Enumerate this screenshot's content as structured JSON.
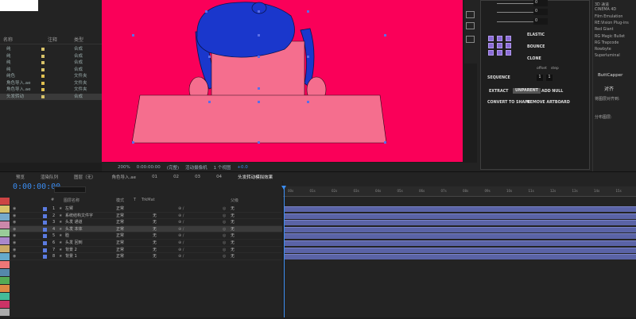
{
  "project": {
    "columns": {
      "name": "名称",
      "label": "注释",
      "type": "类型"
    },
    "rows": [
      {
        "name": "纯",
        "type": "合成",
        "swatch": "#d8c36a"
      },
      {
        "name": "纯",
        "type": "合成",
        "swatch": "#d8c36a"
      },
      {
        "name": "纯",
        "type": "合成",
        "swatch": "#d8c36a"
      },
      {
        "name": "纯",
        "type": "合成",
        "swatch": "#d8c36a"
      },
      {
        "name": "纯色",
        "type": "文件夹",
        "swatch": "#e0c050"
      },
      {
        "name": "角色导入.ae",
        "type": "文件夹",
        "swatch": "#e0c050"
      },
      {
        "name": "角色导入.ae",
        "type": "文件夹",
        "swatch": "#e0c050"
      },
      {
        "name": "头发转动",
        "type": "合成",
        "swatch": "#d8c36a",
        "selected": true
      }
    ]
  },
  "viewer": {
    "zoom": "200%",
    "timecode": "0:00:00:00",
    "resolution": "(完整)",
    "camera": "活动摄像机",
    "views": "1 个视图",
    "offset": "+0.0"
  },
  "motion_panel": {
    "elastic": "ELASTIC",
    "bounce": "BOUNCE",
    "clone": "CLONE",
    "offset": "offset",
    "step": "step",
    "sequence": "SEQUENCE",
    "seq_a": "1",
    "seq_b": "1",
    "extract": "EXTRACT",
    "unparent": "UNPARENT",
    "add_null": "ADD NULL",
    "convert": "CONVERT TO SHAPE",
    "remove_artboard": "REMOVE ARTBOARD",
    "slider_vals": [
      "0",
      "0",
      "0"
    ]
  },
  "effects": {
    "items": [
      "3D 通道",
      "CINEMA 4D",
      "Film Emulation",
      "RE:Vision Plug-ins",
      "Red Giant",
      "RG Magic Bullet",
      "RG Trapcode",
      "Rowbyte",
      "Superluminal"
    ],
    "panel_title": "ButtCapper",
    "align_title": "对齐",
    "align_to": "将图层对齐到:",
    "distribute": "分布图层:"
  },
  "timeline": {
    "tabs": [
      "预览",
      "渲染队列",
      "图层（无）",
      "角色导入.ae",
      "01",
      "02",
      "03",
      "04",
      "头发转动模拟效果"
    ],
    "timecode": "0:00:00:00",
    "columns": {
      "num": "#",
      "name": "图层名称",
      "mode": "模式",
      "t": "T",
      "trkmat": "TrkMat",
      "parent": "父级"
    },
    "layers": [
      {
        "num": "1",
        "name": "左臂",
        "mode": "正常",
        "trkmat": "",
        "parent": "无"
      },
      {
        "num": "2",
        "name": "系统结构文件字",
        "mode": "正常",
        "trkmat": "无",
        "parent": "无"
      },
      {
        "num": "3",
        "name": "头发 通道",
        "mode": "正常",
        "trkmat": "无",
        "parent": "无"
      },
      {
        "num": "4",
        "name": "头发 本体",
        "mode": "正常",
        "trkmat": "无",
        "parent": "无",
        "selected": true
      },
      {
        "num": "5",
        "name": "脸",
        "mode": "正常",
        "trkmat": "无",
        "parent": "无"
      },
      {
        "num": "6",
        "name": "头发 回到",
        "mode": "正常",
        "trkmat": "无",
        "parent": "无"
      },
      {
        "num": "7",
        "name": "背景 2",
        "mode": "正常",
        "trkmat": "无",
        "parent": "无"
      },
      {
        "num": "8",
        "name": "背景 1",
        "mode": "正常",
        "trkmat": "无",
        "parent": "无"
      }
    ],
    "ruler": [
      "00s",
      "01s",
      "02s",
      "03s",
      "04s",
      "05s",
      "06s",
      "07s",
      "08s",
      "09s",
      "10s",
      "11s",
      "12s",
      "13s",
      "14s",
      "15s"
    ]
  },
  "colors": {
    "accent": "#3b8cf0",
    "comp_bg": "#fa0059",
    "face": "#f56e8e",
    "hair": "#1a37cc",
    "bar": "#5a63a6"
  }
}
